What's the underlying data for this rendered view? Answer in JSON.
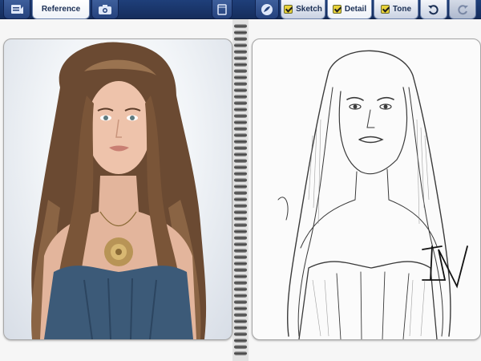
{
  "toolbar": {
    "tabs": {
      "reference": "Reference",
      "sketch": "Sketch",
      "detail": "Detail",
      "tone": "Tone"
    },
    "icons": {
      "gallery": "gallery-icon",
      "camera": "camera-icon",
      "layers": "layers-icon",
      "brush": "brush-icon",
      "undo": "undo-icon",
      "redo": "redo-icon"
    }
  },
  "panels": {
    "reference": "reference-photo",
    "drawing": "pencil-sketch"
  },
  "colors": {
    "toolbar": "#1f3f7a",
    "tab_light": "#eef2f8",
    "checkbox": "#e8d23a",
    "paper": "#f6f6f6"
  }
}
